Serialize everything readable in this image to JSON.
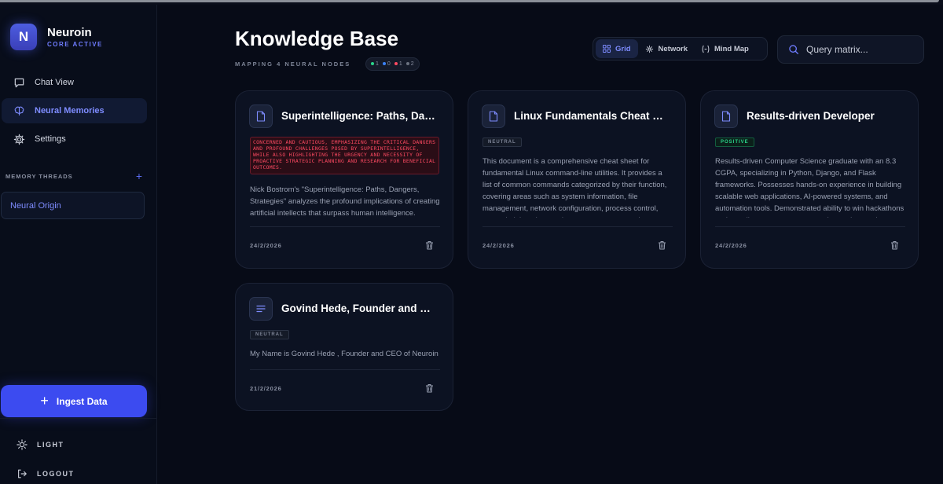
{
  "brand": {
    "initial": "N",
    "name": "Neuroin",
    "status": "CORE ACTIVE"
  },
  "nav": [
    {
      "label": "Chat View",
      "icon": "chat-icon",
      "active": false
    },
    {
      "label": "Neural Memories",
      "icon": "brain-icon",
      "active": true
    },
    {
      "label": "Settings",
      "icon": "gear-icon",
      "active": false
    }
  ],
  "threads": {
    "header": "MEMORY THREADS",
    "items": [
      "Neural Origin"
    ]
  },
  "ingest_label": "Ingest Data",
  "bottom": {
    "theme_label": "LIGHT",
    "logout_label": "LOGOUT"
  },
  "main": {
    "title": "Knowledge Base",
    "subtitle": "MAPPING 4 NEURAL NODES",
    "stats": [
      {
        "value": "1",
        "color": "#2ad48a"
      },
      {
        "value": "0",
        "color": "#3b82f6"
      },
      {
        "value": "1",
        "color": "#ff4a62"
      },
      {
        "value": "2",
        "color": "#6b7280"
      }
    ]
  },
  "views": [
    {
      "label": "Grid",
      "icon": "grid-icon",
      "active": true
    },
    {
      "label": "Network",
      "icon": "network-icon",
      "active": false
    },
    {
      "label": "Mind Map",
      "icon": "mindmap-icon",
      "active": false
    }
  ],
  "search": {
    "placeholder": "Query matrix..."
  },
  "cards": [
    {
      "title": "Superintelligence: Paths, Dangers, Strategies",
      "icon": "document-icon",
      "sentiment": "CONCERNED AND CAUTIOUS, EMPHASIZING THE CRITICAL DANGERS AND PROFOUND CHALLENGES POSED BY SUPERINTELLIGENCE, WHILE ALSO HIGHLIGHTING THE URGENCY AND NECESSITY OF PROACTIVE STRATEGIC PLANNING AND RESEARCH FOR BENEFICIAL OUTCOMES.",
      "summary": "Nick Bostrom's \"Superintelligence: Paths, Dangers, Strategies\" analyzes the profound implications of creating artificial intellects that surpass human intelligence.",
      "date": "24/2/2026"
    },
    {
      "title": "Linux Fundamentals Cheat Sheet",
      "icon": "document-icon",
      "sentiment": "NEUTRAL",
      "summary": "This document is a comprehensive cheat sheet for fundamental Linux command-line utilities. It provides a list of common commands categorized by their function, covering areas such as system information, file management, network configuration, process control, user administration, package management, and text processing.",
      "date": "24/2/2026"
    },
    {
      "title": "Results-driven Developer",
      "icon": "document-icon",
      "sentiment": "POSITIVE",
      "summary": "Results-driven Computer Science graduate with an 8.3 CGPA, specializing in Python, Django, and Flask frameworks. Possesses hands-on experience in building scalable web applications, AI-powered systems, and automation tools. Demonstrated ability to win hackathons and contribute to open-source projects, showcasing strong problem-solving skills.",
      "date": "24/2/2026"
    },
    {
      "title": "Govind Hede, Founder and CEO of Neuroin",
      "icon": "text-lines-icon",
      "sentiment": "NEUTRAL",
      "summary": "My Name is Govind Hede , Founder and CEO of Neuroin",
      "date": "21/2/2026"
    }
  ]
}
